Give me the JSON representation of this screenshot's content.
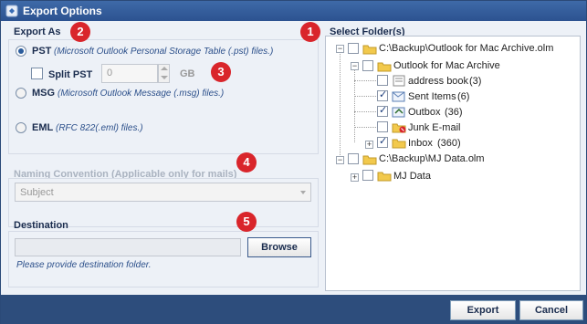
{
  "window": {
    "title": "Export Options"
  },
  "export_as": {
    "title": "Export As",
    "options": [
      {
        "label": "PST",
        "desc": "(Microsoft Outlook Personal Storage Table (.pst) files.)",
        "selected": true
      },
      {
        "label": "MSG",
        "desc": "(Microsoft Outlook Message (.msg) files.)",
        "selected": false
      },
      {
        "label": "EML",
        "desc": "(RFC 822(.eml) files.)",
        "selected": false
      }
    ],
    "split_pst": {
      "label": "Split PST",
      "checked": false,
      "value": "0",
      "unit": "GB"
    }
  },
  "naming": {
    "title": "Naming Convention (Applicable only for mails)",
    "selected": "Subject"
  },
  "destination": {
    "title": "Destination",
    "value": "",
    "browse_label": "Browse",
    "hint": "Please provide destination folder."
  },
  "folders": {
    "title": "Select Folder(s)",
    "nodes": [
      {
        "label": "C:\\Backup\\Outlook for Mac Archive.olm",
        "count": ""
      },
      {
        "label": "Outlook for Mac Archive",
        "count": ""
      },
      {
        "label": "address book",
        "count": "(3)"
      },
      {
        "label": "Sent Items",
        "count": "(6)"
      },
      {
        "label": "Outbox",
        "count": "(36)"
      },
      {
        "label": "Junk E-mail",
        "count": ""
      },
      {
        "label": "Inbox",
        "count": "(360)"
      },
      {
        "label": "C:\\Backup\\MJ Data.olm",
        "count": ""
      },
      {
        "label": "MJ Data",
        "count": ""
      }
    ]
  },
  "badges": [
    "1",
    "2",
    "3",
    "4",
    "5"
  ],
  "footer": {
    "export_label": "Export",
    "cancel_label": "Cancel"
  },
  "colors": {
    "accent": "#2d4d7c",
    "badge": "#d9252b",
    "hint": "#2b4f8a"
  }
}
